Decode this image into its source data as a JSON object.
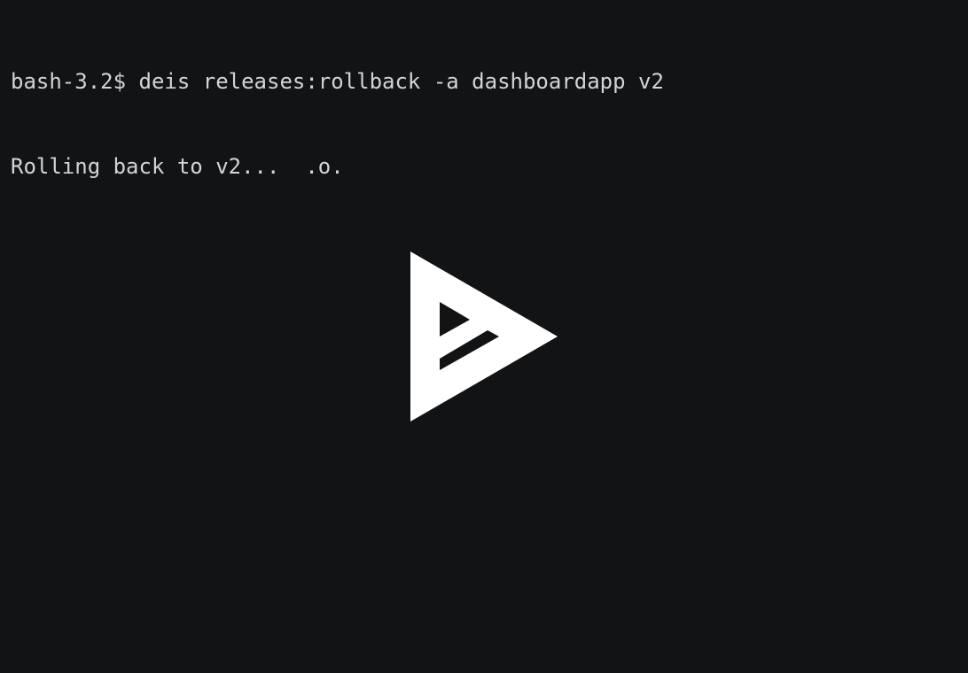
{
  "terminal": {
    "prompt": "bash-3.2$",
    "command": "deis releases:rollback -a dashboardapp v2",
    "output": "Rolling back to v2...  .o."
  },
  "player": {
    "icon": "asciinema-play-icon",
    "icon_color": "#ffffff",
    "background": "#121315",
    "text_color": "#d4d4d4"
  }
}
